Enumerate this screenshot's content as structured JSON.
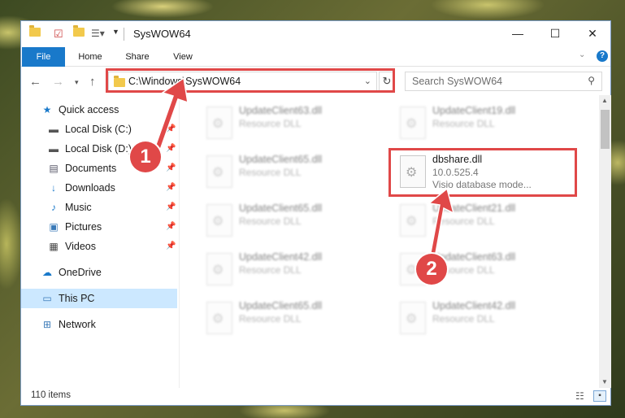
{
  "window": {
    "title": "SysWOW64",
    "minimize": "—",
    "maximize": "☐",
    "close": "✕"
  },
  "ribbon": {
    "tabs": [
      "File",
      "Home",
      "Share",
      "View"
    ]
  },
  "address": {
    "path": "C:\\Windows\\SysWOW64",
    "search_placeholder": "Search SysWOW64"
  },
  "sidebar": {
    "items": [
      {
        "label": "Quick access",
        "icon": "star-icon",
        "pinned": false
      },
      {
        "label": "Local Disk (C:)",
        "icon": "drive-icon",
        "pinned": true
      },
      {
        "label": "Local Disk (D:)",
        "icon": "drive-icon",
        "pinned": true
      },
      {
        "label": "Documents",
        "icon": "documents-icon",
        "pinned": true
      },
      {
        "label": "Downloads",
        "icon": "download-icon",
        "pinned": true
      },
      {
        "label": "Music",
        "icon": "music-icon",
        "pinned": true
      },
      {
        "label": "Pictures",
        "icon": "pictures-icon",
        "pinned": true
      },
      {
        "label": "Videos",
        "icon": "videos-icon",
        "pinned": true
      },
      {
        "label": "OneDrive",
        "icon": "cloud-icon",
        "pinned": false
      },
      {
        "label": "This PC",
        "icon": "computer-icon",
        "pinned": false
      },
      {
        "label": "Network",
        "icon": "network-icon",
        "pinned": false
      }
    ]
  },
  "files": {
    "left": [
      {
        "name": "UpdateClient63.dll",
        "desc": "Resource DLL"
      },
      {
        "name": "UpdateClient65.dll",
        "desc": "Resource DLL"
      },
      {
        "name": "UpdateClient65.dll",
        "desc": "Resource DLL"
      },
      {
        "name": "UpdateClient42.dll",
        "desc": "Resource DLL"
      },
      {
        "name": "UpdateClient65.dll",
        "desc": "Resource DLL"
      }
    ],
    "right": [
      {
        "name": "UpdateClient19.dll",
        "desc": "Resource DLL"
      },
      {
        "name": "UpdateClient21.dll",
        "desc": "Resource DLL"
      },
      {
        "name": "UpdateClient63.dll",
        "desc": "Resource DLL"
      },
      {
        "name": "UpdateClient42.dll",
        "desc": "Resource DLL"
      }
    ],
    "highlighted": {
      "name": "dbshare.dll",
      "version": "10.0.525.4",
      "desc": "Visio database mode..."
    }
  },
  "status": {
    "item_count": "110 items"
  },
  "annotations": {
    "step1": "1",
    "step2": "2",
    "color": "#e04848"
  }
}
